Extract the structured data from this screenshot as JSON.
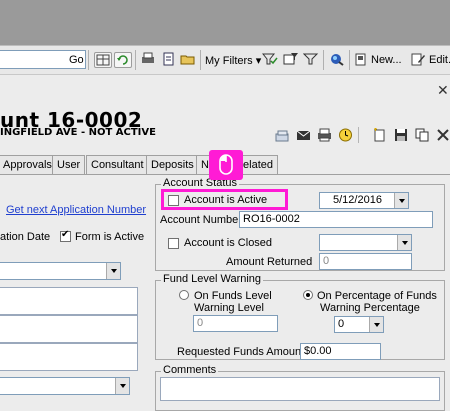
{
  "toolbar": {
    "go_label": "Go",
    "my_filters_label": "My Filters",
    "new_label": "New...",
    "edit_label": "Edit.."
  },
  "header": {
    "title": "unt 16-0002",
    "subtitle": "INGFIELD AVE - NOT ACTIVE",
    "close_glyph": "✕"
  },
  "tabs": [
    {
      "label": "Approvals"
    },
    {
      "label": "User"
    },
    {
      "label": "Consultant"
    },
    {
      "label": "Deposits"
    },
    {
      "label": "N"
    },
    {
      "label": "Related"
    }
  ],
  "left_panel": {
    "link_text": "Get next Application Number",
    "application_date_label": "ation Date",
    "form_active_label": "Form is Active",
    "form_active_checked": true
  },
  "account_status": {
    "legend": "Account Status",
    "account_active_label": "Account is Active",
    "account_active_checked": false,
    "date_value": "5/12/2016",
    "account_number_label": "Account Number",
    "account_number_value": "RO16-0002",
    "account_closed_label": "Account is Closed",
    "account_closed_checked": false,
    "amount_returned_label": "Amount Returned",
    "amount_returned_value": "0"
  },
  "fund_level": {
    "legend": "Fund Level Warning",
    "radio1_label_line1": "On Funds Level",
    "radio1_label_line2": "Warning Level",
    "radio1_checked": false,
    "warning_level_value": "0",
    "radio2_label_line1": "On Percentage of Funds",
    "radio2_label_line2": "Warning Percentage",
    "radio2_checked": true,
    "warning_percentage_value": "0",
    "requested_funds_label": "Requested Funds Amount",
    "requested_funds_value": "$0.00"
  },
  "comments": {
    "legend": "Comments"
  },
  "colors": {
    "highlight": "#ff1bd5",
    "link": "#1f3fcf"
  }
}
